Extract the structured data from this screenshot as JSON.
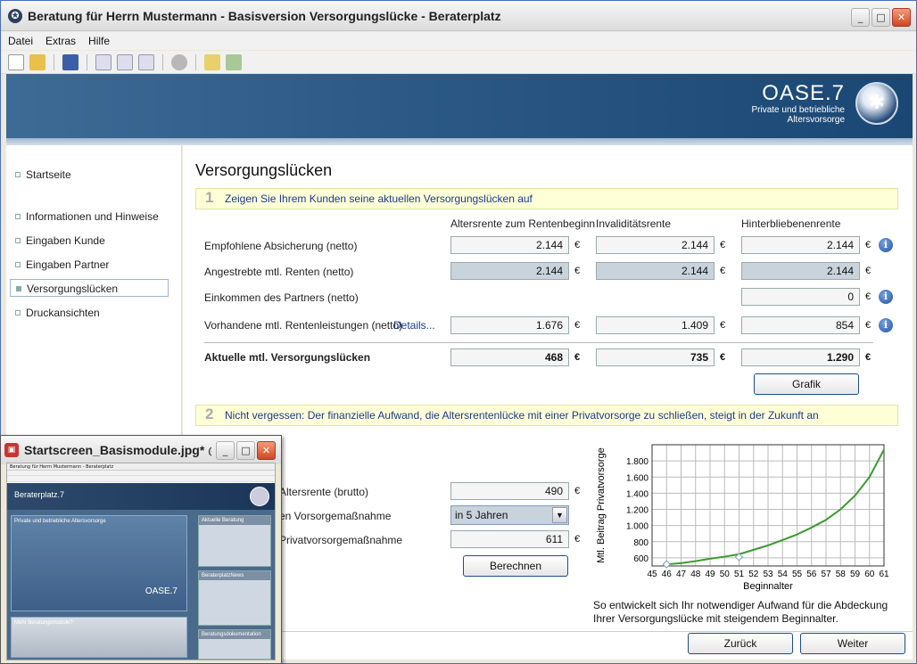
{
  "window": {
    "title": "Beratung für Herrn Mustermann - Basisversion Versorgungslücke - Beraterplatz",
    "app_icon": "✪"
  },
  "menu": [
    "Datei",
    "Extras",
    "Hilfe"
  ],
  "banner": {
    "brand": "OASE.7",
    "subtitle_line1": "Private und betriebliche",
    "subtitle_line2": "Altersvorsorge"
  },
  "sidebar": {
    "items": [
      {
        "label": "Startseite"
      },
      {
        "label": "Informationen und Hinweise"
      },
      {
        "label": "Eingaben Kunde"
      },
      {
        "label": "Eingaben Partner"
      },
      {
        "label": "Versorgungslücken",
        "active": true
      },
      {
        "label": "Druckansichten"
      }
    ]
  },
  "main": {
    "heading": "Versorgungslücken",
    "step1": {
      "num": "1",
      "text": "Zeigen Sie Ihrem Kunden seine aktuellen Versorgungslücken auf"
    },
    "columns": [
      "Altersrente zum Rentenbeginn",
      "Invaliditätsrente",
      "Hinterbliebenenrente"
    ],
    "currency": "€",
    "rows": [
      {
        "label": "Empfohlene Absicherung (netto)",
        "values": [
          "2.144",
          "2.144",
          "2.144"
        ]
      },
      {
        "label": "Angestrebte mtl. Renten (netto)",
        "values": [
          "2.144",
          "2.144",
          "2.144"
        ]
      },
      {
        "label": "Einkommen des Partners (netto)",
        "values": [
          "",
          "",
          "0"
        ]
      },
      {
        "label": "Vorhandene mtl. Rentenleistungen (netto)",
        "link": "Details...",
        "values": [
          "1.676",
          "1.409",
          "854"
        ]
      }
    ],
    "total": {
      "label": "Aktuelle mtl. Versorgungslücken",
      "values": [
        "468",
        "735",
        "1.290"
      ]
    },
    "grafik_button": "Grafik",
    "step2": {
      "num": "2",
      "text": "Nicht vergessen: Der finanzielle Aufwand, die Altersrentenlücke mit einer Privatvorsorge zu schließen, steigt in der Zukunft an"
    },
    "calc": {
      "label_rente": "Altersrente (brutto)",
      "value_rente": "490",
      "label_massnahme": "en Vorsorgemaßnahme",
      "select_value": "in 5 Jahren",
      "label_privat": "Privatvorsorgemaßnahme",
      "value_privat": "611",
      "berechnen_button": "Berechnen"
    },
    "chart_caption": "So entwickelt sich Ihr notwendiger Aufwand für die Abdeckung Ihrer Versorgungslücke mit steigendem Beginnalter."
  },
  "chart_data": {
    "type": "line",
    "title": "",
    "xlabel": "Beginnalter",
    "ylabel": "Mtl. Beitrag Privatvorsorge",
    "xlim": [
      45,
      61
    ],
    "ylim": [
      500,
      2000
    ],
    "x_ticks": [
      45,
      46,
      47,
      48,
      49,
      50,
      51,
      52,
      53,
      54,
      55,
      56,
      57,
      58,
      59,
      60,
      61
    ],
    "y_ticks": [
      600,
      800,
      1000,
      1200,
      1400,
      1600,
      1800
    ],
    "y_tick_labels": [
      "600",
      "800",
      "1.000",
      "1.200",
      "1.400",
      "1.600",
      "1.800"
    ],
    "grid": true,
    "color": "#3a9a2e",
    "series": [
      {
        "name": "",
        "x": [
          46,
          47,
          48,
          49,
          50,
          51,
          52,
          53,
          54,
          55,
          56,
          57,
          58,
          59,
          60,
          61
        ],
        "y": [
          520,
          535,
          560,
          590,
          615,
          645,
          700,
          755,
          820,
          890,
          975,
          1070,
          1200,
          1370,
          1600,
          1940
        ]
      }
    ],
    "markers": [
      {
        "x": 46,
        "y": 520
      },
      {
        "x": 51,
        "y": 611
      }
    ]
  },
  "footer": {
    "back_button": "Zurück",
    "next_button": "Weiter"
  },
  "overlay_window": {
    "title": "Startscreen_Basismodule.jpg* @...",
    "mini_title": "Beratung für Herrn Mustermann - Beraterplatz",
    "mini_brand": "Beraterplatz.7",
    "panel1": "Private und betriebliche Altersvorsorge",
    "panel2": "Mehr Beratungsmodule?",
    "side1": "Aktuelle Beratung",
    "side2": "BeraterplatzNews",
    "side3": "Beratungsdokumentation",
    "oase": "OASE.7"
  },
  "colors": {
    "accent": "#1a3b8a",
    "banner": "#2d5a87",
    "step_bg": "#ffffd7",
    "line": "#3a9a2e"
  }
}
